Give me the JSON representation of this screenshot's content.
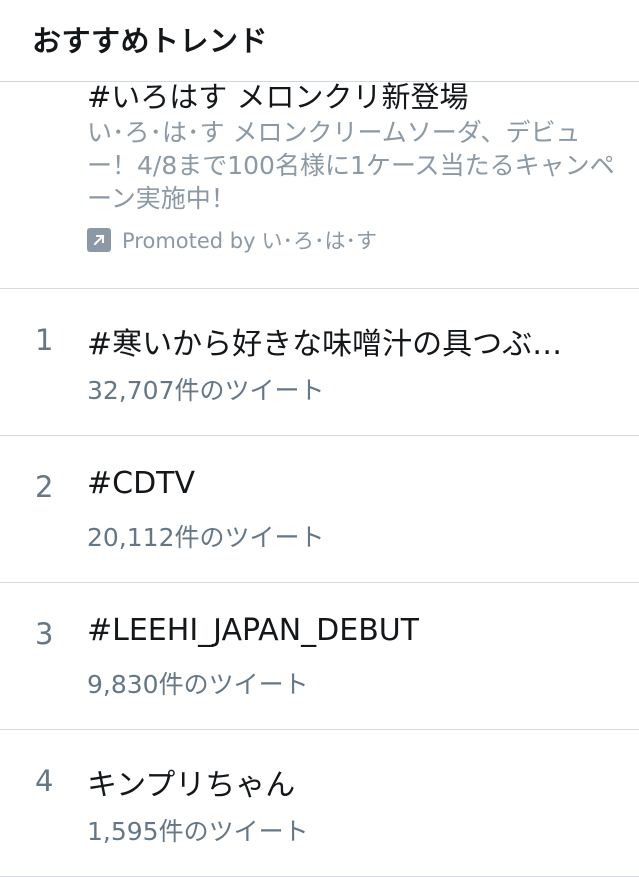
{
  "header": {
    "title": "おすすめトレンド"
  },
  "promoted": {
    "title": "#いろはす メロンクリ新登場",
    "description": "い･ろ･は･す メロンクリームソーダ、デビュー！4/8まで100名様に1ケース当たるキャンペーン実施中！",
    "promoted_label": "Promoted by",
    "advertiser": "い･ろ･は･す",
    "icon": "promoted-arrow-icon"
  },
  "trends": [
    {
      "rank": "1",
      "name": "#寒いから好きな味噌汁の具つぶ…",
      "count": "32,707件のツイート"
    },
    {
      "rank": "2",
      "name": "#CDTV",
      "count": "20,112件のツイート"
    },
    {
      "rank": "3",
      "name": "#LEEHI_JAPAN_DEBUT",
      "count": "9,830件のツイート"
    },
    {
      "rank": "4",
      "name": "キンプリちゃん",
      "count": "1,595件のツイート"
    }
  ],
  "colors": {
    "text_primary": "#14171a",
    "text_secondary": "#657786",
    "text_promo": "#8b98a5",
    "divider": "#d6dde2"
  }
}
